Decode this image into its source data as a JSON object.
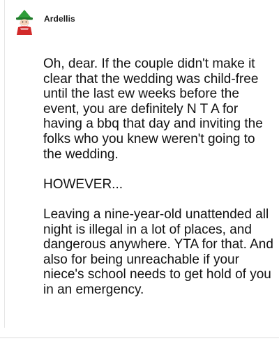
{
  "comment": {
    "author": "Ardellis",
    "avatar_icon": "gnome-avatar-icon",
    "paragraphs": [
      "Oh, dear. If the couple didn't make it clear that the wedding was child-free until the last ew weeks before the event, you are definitely N T A for having a bbq that day and inviting the folks who you knew weren't going to the wedding.",
      "HOWEVER...",
      "Leaving a nine-year-old unattended all night is illegal in a lot of places, and dangerous anywhere. YTA for that. And also for being unreachable if your niece's school needs to get hold of you in an emergency."
    ]
  },
  "colors": {
    "hat": "#2f9e3a",
    "scarf": "#d22a2a",
    "text": "#111111"
  }
}
